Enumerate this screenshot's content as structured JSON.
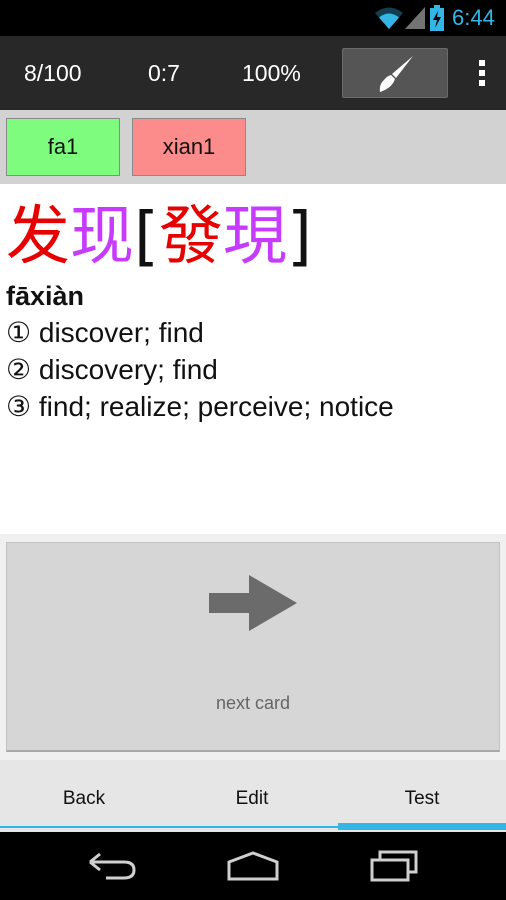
{
  "status_bar": {
    "time": "6:44",
    "icons": [
      "wifi-icon",
      "signal-icon",
      "battery-charging-icon"
    ],
    "accent_color": "#33b5e5"
  },
  "action_bar": {
    "progress": "8/100",
    "timer": "0:7",
    "percent": "100%",
    "icons": [
      "paintbrush-icon",
      "overflow-menu-icon"
    ]
  },
  "syllables": [
    {
      "label": "fa1",
      "color": "#7dfc7d"
    },
    {
      "label": "xian1",
      "color": "#fc8c8c"
    }
  ],
  "card": {
    "simplified": [
      {
        "char": "发",
        "color": "#e60000"
      },
      {
        "char": "现",
        "color": "#c63bff"
      }
    ],
    "bracket_open": "[",
    "traditional": [
      {
        "char": "發",
        "color": "#e60000"
      },
      {
        "char": "現",
        "color": "#c63bff"
      }
    ],
    "bracket_close": "]",
    "pinyin": "fāxiàn",
    "definitions": [
      "① discover; find",
      "② discovery; find",
      "③ find; realize; perceive; notice"
    ]
  },
  "next_card": {
    "label": "next card",
    "icon": "arrow-right-icon"
  },
  "tabs": [
    {
      "label": "Back",
      "selected": false
    },
    {
      "label": "Edit",
      "selected": false
    },
    {
      "label": "Test",
      "selected": true
    }
  ],
  "nav_bar": {
    "icons": [
      "back-nav-icon",
      "home-nav-icon",
      "recents-nav-icon"
    ]
  }
}
